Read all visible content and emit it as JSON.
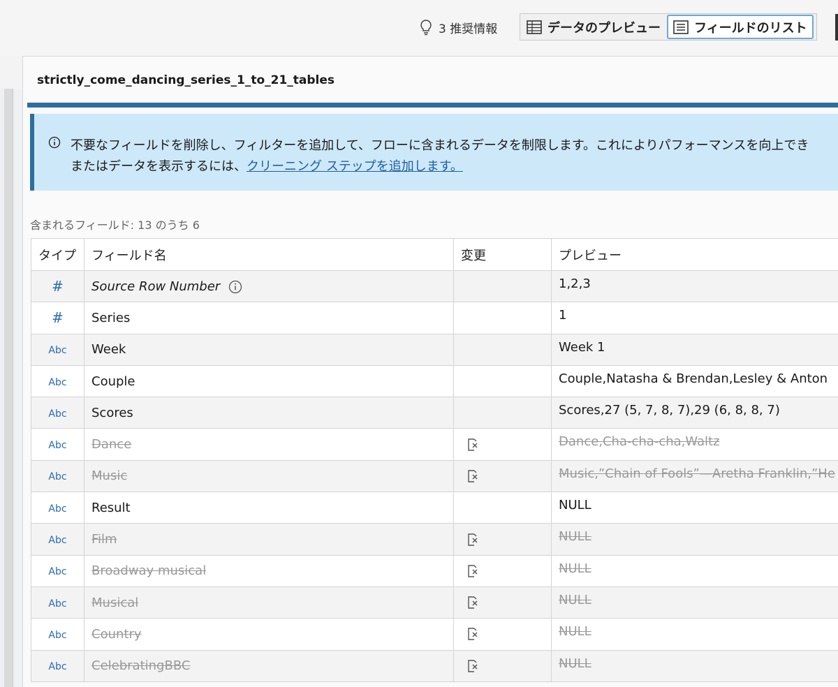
{
  "toolbar": {
    "recommendations_label": "3 推奨情報",
    "data_preview_label": "データのプレビュー",
    "field_list_label": "フィールドのリスト"
  },
  "panel": {
    "title": "strictly_come_dancing_series_1_to_21_tables",
    "info_line1": "不要なフィールドを削除し、フィルターを追加して、フローに含まれるデータを制限します。これによりパフォーマンスを向上でき",
    "info_line2_prefix": "またはデータを表示するには、",
    "info_link": "クリーニング ステップを追加します。",
    "field_count": "含まれるフィールド: 13 のうち 6"
  },
  "table": {
    "headers": [
      "タイプ",
      "フィールド名",
      "変更",
      "プレビュー"
    ],
    "rows": [
      {
        "type": "#",
        "name": "Source Row Number",
        "preview": "1,2,3",
        "removed": false
      },
      {
        "type": "#",
        "name": "Series",
        "preview": "1",
        "removed": false
      },
      {
        "type": "Abc",
        "name": "Week",
        "preview": "Week 1",
        "removed": false
      },
      {
        "type": "Abc",
        "name": "Couple",
        "preview": "Couple,Natasha & Brendan,Lesley & Anton",
        "removed": false
      },
      {
        "type": "Abc",
        "name": "Scores",
        "preview": "Scores,27 (5, 7, 8, 7),29 (6, 8, 8, 7)",
        "removed": false
      },
      {
        "type": "Abc",
        "name": "Dance",
        "preview": "Dance,Cha-cha-cha,Waltz",
        "removed": true
      },
      {
        "type": "Abc",
        "name": "Music",
        "preview": "Music,”Chain of Fools”—Aretha Franklin,”He",
        "removed": true
      },
      {
        "type": "Abc",
        "name": "Result",
        "preview": "NULL",
        "removed": false
      },
      {
        "type": "Abc",
        "name": "Film",
        "preview": "NULL",
        "removed": true
      },
      {
        "type": "Abc",
        "name": "Broadway musical",
        "preview": "NULL",
        "removed": true
      },
      {
        "type": "Abc",
        "name": "Musical",
        "preview": "NULL",
        "removed": true
      },
      {
        "type": "Abc",
        "name": "Country",
        "preview": "NULL",
        "removed": true
      },
      {
        "type": "Abc",
        "name": "CelebratingBBC",
        "preview": "NULL",
        "removed": true
      }
    ]
  },
  "colors": {
    "accent": "#2e6e9e",
    "info_bg": "#cde8f9",
    "type_blue": "#2a6bb0",
    "removed_gray": "#999999"
  },
  "icons": {
    "recommendations": "lightbulb-icon",
    "data_preview": "table-grid-icon",
    "field_list": "list-icon",
    "info": "info-circle-icon",
    "row_info": "info-circle-icon",
    "removed": "remove-field-icon"
  }
}
